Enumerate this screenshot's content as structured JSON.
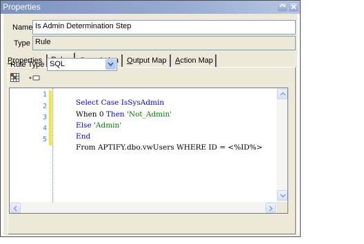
{
  "window": {
    "title": "Properties"
  },
  "fields": {
    "name_label": "Name",
    "name_value": "Is Admin Determination Step",
    "type_label": "Type",
    "type_value": "Rule"
  },
  "tabs": [
    {
      "pre": "",
      "accel": "P",
      "post": "roperties",
      "active": false
    },
    {
      "pre": "",
      "accel": "R",
      "post": "ule",
      "active": true
    },
    {
      "pre": "",
      "accel": "D",
      "post": "escription",
      "active": false
    },
    {
      "pre": "",
      "accel": "O",
      "post": "utput Map",
      "active": false
    },
    {
      "pre": "",
      "accel": "A",
      "post": "ction Map",
      "active": false
    }
  ],
  "rule": {
    "rule_type_label": "Rule Type",
    "rule_type_value": "SQL",
    "toolbar_icons": [
      "grid-icon",
      "key-icon"
    ]
  },
  "editor": {
    "line_numbers": [
      "1",
      "2",
      "3",
      "4",
      "5"
    ],
    "lines": [
      [
        {
          "t": "Select Case ",
          "c": "kw"
        },
        {
          "t": "IsSysAdmin",
          "c": "kw"
        }
      ],
      [
        {
          "t": "When 0 ",
          "c": "code-text"
        },
        {
          "t": "Then ",
          "c": "kw"
        },
        {
          "t": "'Not_Admin'",
          "c": "str"
        }
      ],
      [
        {
          "t": "Else ",
          "c": "kw"
        },
        {
          "t": "'Admin'",
          "c": "str"
        }
      ],
      [
        {
          "t": "End",
          "c": "kw"
        }
      ],
      [
        {
          "t": "From APTIFY.dbo.vwUsers WHERE ID = <%ID%>",
          "c": "code-text"
        }
      ]
    ]
  },
  "colors": {
    "titlebar": "#8fa3cc",
    "panel": "#ece9d8",
    "keyword": "#0000ff",
    "string": "#008000",
    "line_number": "#2b91af",
    "change_bar": "#f6e62c"
  }
}
